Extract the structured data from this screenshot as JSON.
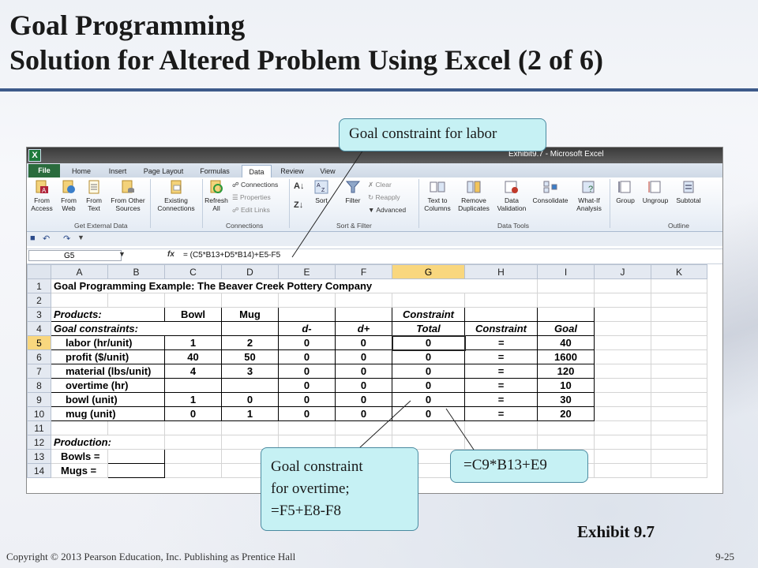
{
  "slide": {
    "title_line1": "Goal Programming",
    "title_line2": "Solution for Altered Problem Using Excel (2 of 6)",
    "exhibit": "Exhibit 9.7",
    "footer": "Copyright © 2013 Pearson Education, Inc. Publishing as Prentice Hall",
    "page_number": "9-25"
  },
  "callouts": {
    "labor": "Goal constraint for labor",
    "overtime_line1": "Goal constraint",
    "overtime_line2": "for overtime;",
    "overtime_line3": "=F5+E8-F8",
    "formula_c9": "=C9*B13+E9"
  },
  "excel": {
    "window_title": "Exhibit9.7 - Microsoft Excel",
    "app_icon": "X",
    "tabs": [
      "File",
      "Home",
      "Insert",
      "Page Layout",
      "Formulas",
      "Data",
      "Review",
      "View"
    ],
    "active_tab": "Data",
    "ribbon": {
      "from_access": "From\nAccess",
      "from_web": "From\nWeb",
      "from_text": "From\nText",
      "from_other": "From Other\nSources",
      "existing": "Existing\nConnections",
      "refresh": "Refresh\nAll",
      "connections": "Connections",
      "properties": "Properties",
      "edit_links": "Edit Links",
      "sort": "Sort",
      "filter": "Filter",
      "clear": "Clear",
      "reapply": "Reapply",
      "advanced": "Advanced",
      "text_to_columns": "Text to\nColumns",
      "remove_duplicates": "Remove\nDuplicates",
      "data_validation": "Data\nValidation",
      "consolidate": "Consolidate",
      "what_if": "What-If\nAnalysis",
      "group": "Group",
      "ungroup": "Ungroup",
      "subtotal": "Subtotal",
      "group_labels": [
        "Get External Data",
        "Connections",
        "Sort & Filter",
        "Data Tools",
        "Outline"
      ]
    },
    "name_box": "G5",
    "fx": "fx",
    "formula": "= (C5*B13+D5*B14)+E5-F5",
    "columns": [
      "A",
      "B",
      "C",
      "D",
      "E",
      "F",
      "G",
      "H",
      "I",
      "J",
      "K"
    ],
    "rows": {
      "r1": "Goal Programming Example: The Beaver Creek Pottery Company",
      "r3": {
        "a": "Products:",
        "c": "Bowl",
        "d": "Mug",
        "g": "Constraint"
      },
      "r4": {
        "a": "Goal constraints:",
        "e": "d-",
        "f": "d+",
        "g": "Total",
        "h": "Constraint",
        "i": "Goal"
      },
      "r5": {
        "a": "labor (hr/unit)",
        "c": "1",
        "d": "2",
        "e": "0",
        "f": "0",
        "g": "0",
        "h": "=",
        "i": "40"
      },
      "r6": {
        "a": "profit ($/unit)",
        "c": "40",
        "d": "50",
        "e": "0",
        "f": "0",
        "g": "0",
        "h": "=",
        "i": "1600"
      },
      "r7": {
        "a": "material (lbs/unit)",
        "c": "4",
        "d": "3",
        "e": "0",
        "f": "0",
        "g": "0",
        "h": "=",
        "i": "120"
      },
      "r8": {
        "a": "overtime (hr)",
        "e": "0",
        "f": "0",
        "g": "0",
        "h": "=",
        "i": "10"
      },
      "r9": {
        "a": "bowl (unit)",
        "c": "1",
        "d": "0",
        "e": "0",
        "f": "0",
        "g": "0",
        "h": "=",
        "i": "30"
      },
      "r10": {
        "a": "mug (unit)",
        "c": "0",
        "d": "1",
        "e": "0",
        "f": "0",
        "g": "0",
        "h": "=",
        "i": "20"
      },
      "r12": {
        "a": "Production:"
      },
      "r13": {
        "a": "Bowls ="
      },
      "r14": {
        "a": "Mugs ="
      }
    },
    "row_numbers": [
      "1",
      "2",
      "3",
      "4",
      "5",
      "6",
      "7",
      "8",
      "9",
      "10",
      "11",
      "12",
      "13",
      "14"
    ]
  }
}
